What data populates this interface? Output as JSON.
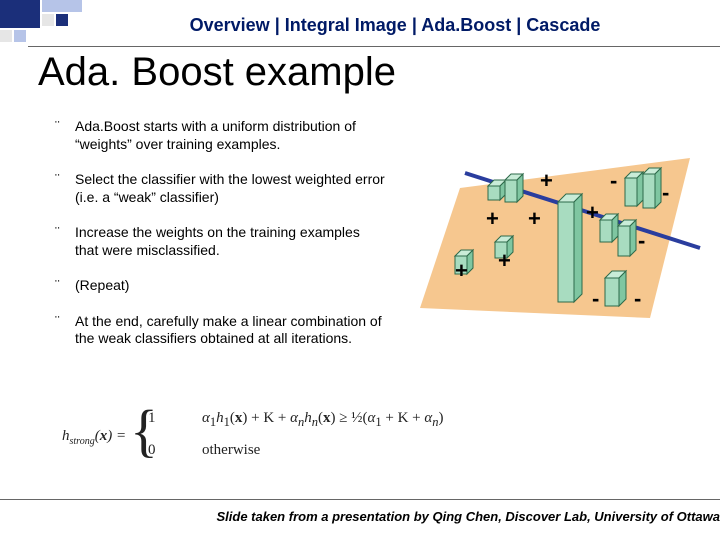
{
  "breadcrumb": {
    "items": [
      "Overview",
      "Integral Image",
      "Ada.Boost",
      "Cascade"
    ],
    "sep": "|"
  },
  "title": "Ada. Boost example",
  "bullets": [
    "Ada.Boost starts with a uniform distribution of “weights” over training examples.",
    "Select the classifier with the lowest weighted error (i.e. a “weak” classifier)",
    "Increase the weights on the training examples that were misclassified.",
    "(Repeat)",
    "At the end, carefully make a linear combination of the weak classifiers obtained at all iterations."
  ],
  "formula": {
    "lhs": "h",
    "lhs_sub": "strong",
    "lhs_arg": "(x) =",
    "case1_val": "1",
    "case1_cond_part1": "α",
    "case1_cond": "α₁h₁(x) + K + αₙhₙ(x) ≥ ½(α₁ + K + αₙ)",
    "case2_val": "0",
    "case2_cond": "otherwise"
  },
  "figure": {
    "plane_color": "#f6c78f",
    "classifier_color": "#2a3d9e",
    "positive_marker": "+",
    "negative_marker": "-",
    "bar_color": "#89c9a6",
    "bar_edge": "#2d6a4a"
  },
  "footer": "Slide taken from a presentation by Qing Chen, Discover Lab, University of Ottawa"
}
